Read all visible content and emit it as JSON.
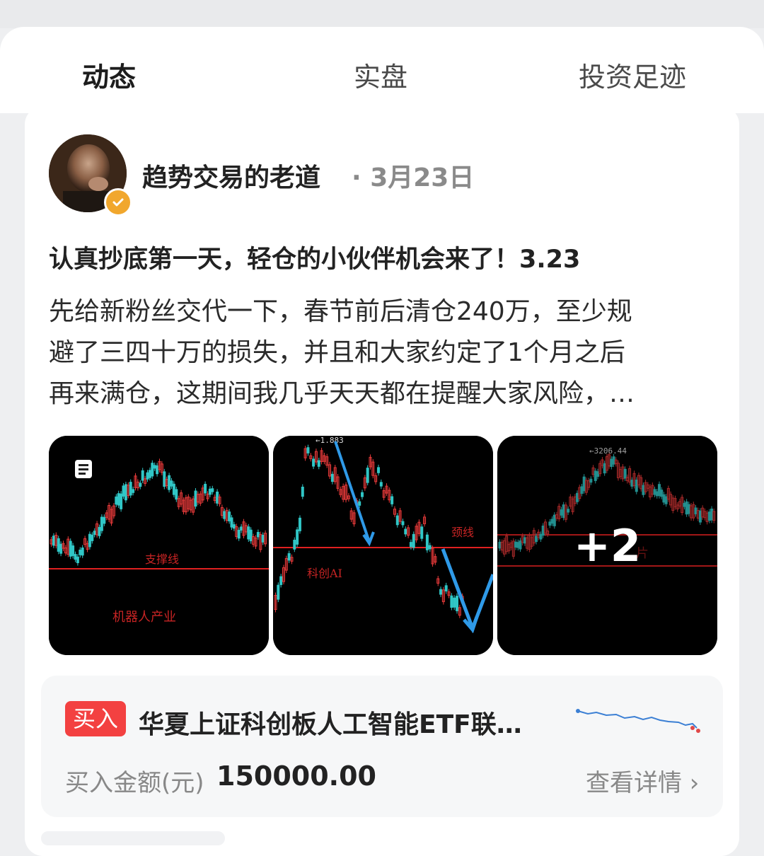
{
  "tabs": [
    {
      "label": "动态",
      "active": true
    },
    {
      "label": "实盘",
      "active": false
    },
    {
      "label": "投资足迹",
      "active": false
    }
  ],
  "post": {
    "author": "趋势交易的老道",
    "date": "· 3月23日",
    "title": "认真抄底第一天，轻仓的小伙伴机会来了！3.23",
    "body_lines": [
      "先给新粉丝交代一下，春节前后清仓240万，至少规",
      "避了三四十万的损失，并且和大家约定了1个月之后",
      "再来满仓，这期间我几乎天天都在提醒大家风险，…"
    ],
    "images": [
      {
        "labels": [
          "支撑线",
          "机器人产业"
        ]
      },
      {
        "labels": [
          "←1.883",
          "颈线",
          "科创AI"
        ]
      },
      {
        "labels": [
          "←3206.44",
          "片"
        ]
      }
    ],
    "more_images": "+2"
  },
  "trade": {
    "badge": "买入",
    "fund_name": "华夏上证科创板人工智能ETF联…",
    "amount_label": "买入金额(元)",
    "amount_value": "150000.00",
    "detail_link": "查看详情 ›"
  },
  "colors": {
    "accent": "#2d6fd6",
    "buy": "#f34141",
    "verified": "#f1a72d",
    "candle_up": "#e83a3a",
    "candle_down": "#30c6c6",
    "chart_line": "#e02020",
    "arrow": "#2f9ae8"
  },
  "icons": [
    "verified-icon",
    "document-icon",
    "chevron-right-icon"
  ]
}
